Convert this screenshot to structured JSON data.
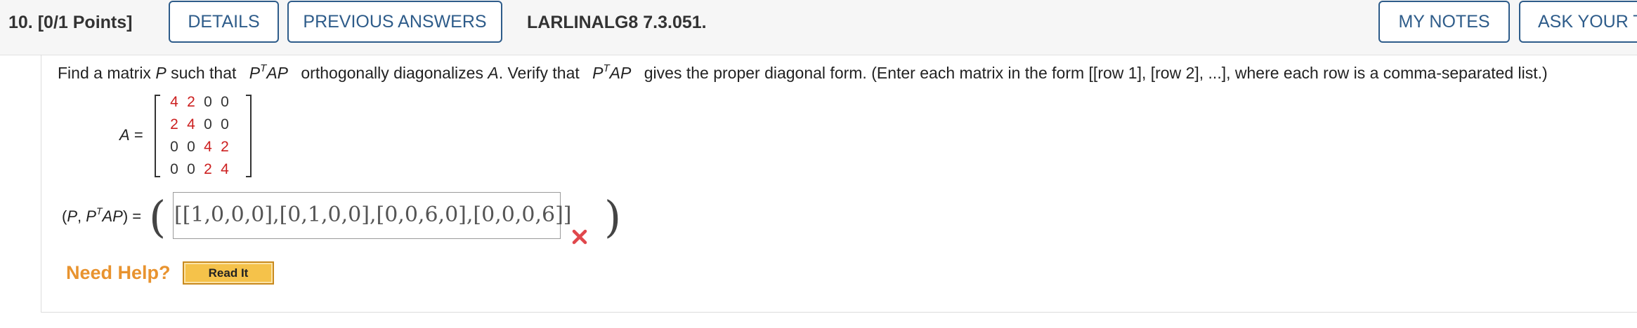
{
  "header": {
    "question_number": "10.",
    "points": "[0/1 Points]",
    "details_label": "DETAILS",
    "previous_answers_label": "PREVIOUS ANSWERS",
    "question_ref": "LARLINALG8 7.3.051.",
    "my_notes_label": "MY NOTES",
    "ask_teacher_label": "ASK YOUR T"
  },
  "question": {
    "text_1": "Find a matrix",
    "var_P": "P",
    "text_2": "such that",
    "expr_P": "P",
    "expr_T": "T",
    "expr_AP": "AP",
    "text_3": "orthogonally diagonalizes",
    "var_A": "A",
    "text_4": ". Verify that",
    "text_5": "gives the proper diagonal form. (Enter each matrix in the form [[row 1], [row 2], ...], where each row is a comma-separated list.)"
  },
  "matrix": {
    "label_var": "A",
    "label_eq": "=",
    "rows": [
      [
        "4",
        "2",
        "0",
        "0"
      ],
      [
        "2",
        "4",
        "0",
        "0"
      ],
      [
        "0",
        "0",
        "4",
        "2"
      ],
      [
        "0",
        "0",
        "2",
        "4"
      ]
    ],
    "highlight_color": "#cc1f1f"
  },
  "answer": {
    "label_open": "(",
    "label_P": "P",
    "label_comma": ", ",
    "label_P2": "P",
    "label_T": "T",
    "label_AP": "AP",
    "label_close": ") =",
    "value": "[[1,0,0,0],[0,1,0,0],[0,0,6,0],[0,0,0,6]]",
    "status": "incorrect"
  },
  "help": {
    "need_help_label": "Need Help?",
    "read_it_label": "Read It"
  },
  "colors": {
    "accent": "#2e5c8a",
    "error": "#e0474c",
    "help": "#e8932f"
  }
}
